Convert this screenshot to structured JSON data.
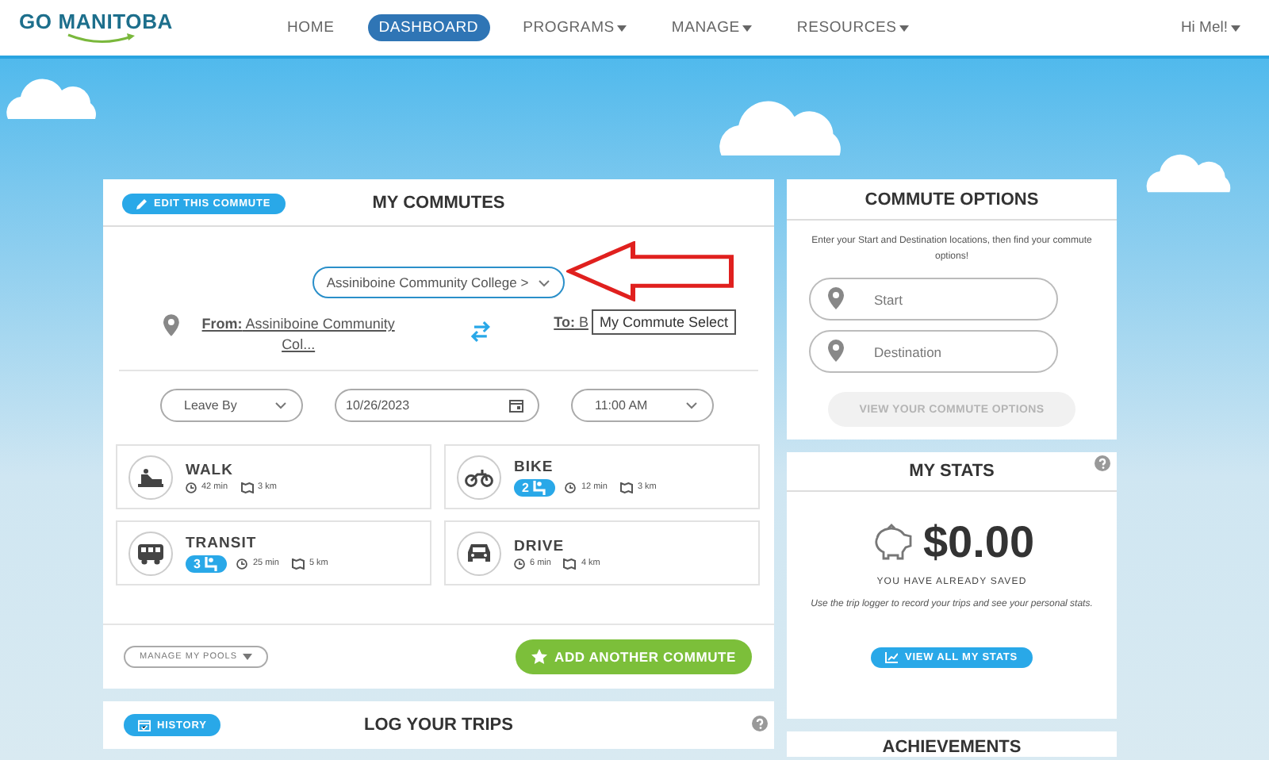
{
  "nav": {
    "logo": "GO MANITOBA",
    "items": [
      {
        "label": "HOME",
        "selected": false,
        "dropdown": false
      },
      {
        "label": "DASHBOARD",
        "selected": true,
        "dropdown": false
      },
      {
        "label": "PROGRAMS",
        "selected": false,
        "dropdown": true
      },
      {
        "label": "MANAGE",
        "selected": false,
        "dropdown": true
      },
      {
        "label": "RESOURCES",
        "selected": false,
        "dropdown": true
      }
    ],
    "user": {
      "label": "Hi Mel!",
      "dropdown": true
    }
  },
  "my_commutes": {
    "edit_button": "EDIT THIS COMMUTE",
    "title": "MY COMMUTES",
    "commute_select": "Assiniboine Community College >",
    "from_link": "**From:** Assiniboine Community Col...",
    "to_link": "**To:** B",
    "tooltip": "My Commute Select",
    "leave_by": "Leave By",
    "date": "10/26/2023",
    "time": "11:00 AM",
    "modes": [
      {
        "kind": "walk",
        "title": "WALK",
        "time": "42 min",
        "distance": "3 km"
      },
      {
        "kind": "bike",
        "title": "BIKE",
        "pool": "2",
        "time": "12 min",
        "distance": "3 km"
      },
      {
        "kind": "transit",
        "title": "TRANSIT",
        "pool": "3",
        "time": "25 min",
        "distance": "5 km"
      },
      {
        "kind": "drive",
        "title": "DRIVE",
        "time": "6 min",
        "distance": "4 km"
      }
    ],
    "manage_pools": "MANAGE MY POOLS",
    "add_button": "ADD ANOTHER COMMUTE"
  },
  "commute_options": {
    "title": "COMMUTE OPTIONS",
    "instructions": "Enter your Start and Destination locations, then find your commute options!",
    "start": {
      "placeholder": "Start"
    },
    "destination": {
      "placeholder": "Destination"
    },
    "view_button": {
      "label": "VIEW YOUR COMMUTE OPTIONS",
      "disabled": true
    }
  },
  "my_stats": {
    "title": "MY STATS",
    "amount": "$0.00",
    "caption": "YOU HAVE ALREADY SAVED",
    "note": "Use the *trip logger* to record your trips and see your personal stats.",
    "button": "VIEW ALL MY STATS"
  },
  "log_trips": {
    "history_button": "HISTORY",
    "title": "LOG YOUR TRIPS"
  },
  "achievements": {
    "title": "ACHIEVEMENTS"
  }
}
